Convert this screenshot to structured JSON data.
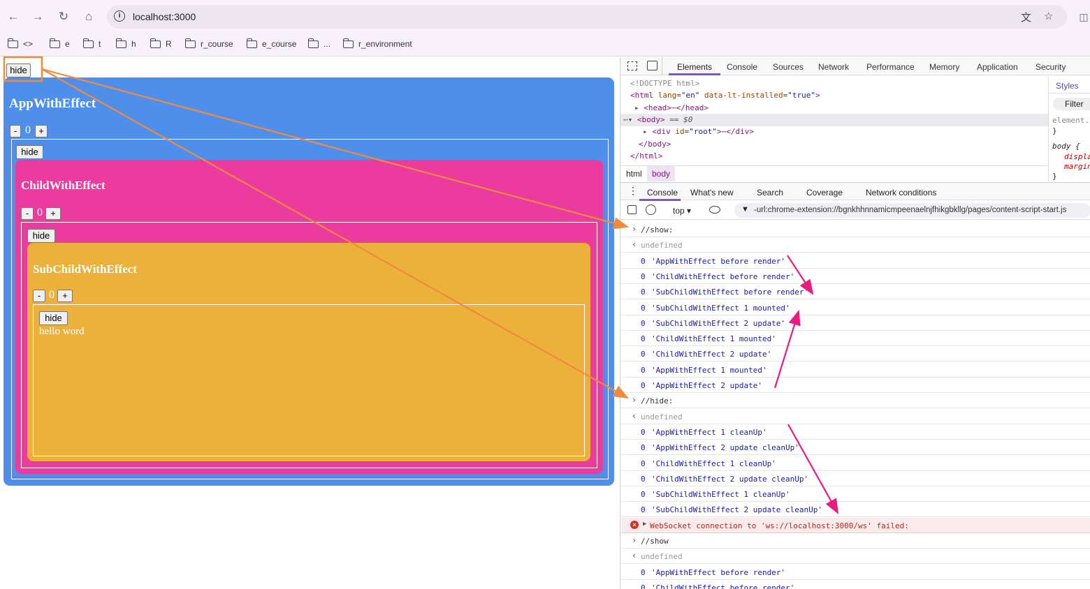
{
  "browser": {
    "url": "localhost:3000",
    "bookmarks": [
      "<>",
      "e",
      "t",
      "h",
      "R",
      "r_course",
      "e_course",
      "...",
      "r_environment"
    ]
  },
  "app": {
    "hide_label": "hide",
    "minus_label": "-",
    "plus_label": "+",
    "app_title": "AppWithEffect",
    "app_count": "0",
    "child_title": "ChildWithEffect",
    "child_count": "0",
    "subchild_title": "SubChildWithEffect",
    "subchild_count": "0",
    "content_text": "hello word",
    "colors": {
      "app": "#4f8fec",
      "child": "#eb3b9f",
      "subchild": "#ecb13a"
    }
  },
  "devtools": {
    "tabs": [
      "Elements",
      "Console",
      "Sources",
      "Network",
      "Performance",
      "Memory",
      "Application",
      "Security"
    ],
    "active_tab": "Elements",
    "elements": {
      "doctype": "<!DOCTYPE html>",
      "html_open_tag": "<html",
      "html_lang_attr": "lang",
      "html_lang_val": "\"en\"",
      "html_lt_attr": "data-lt-installed",
      "html_lt_val": "\"true\"",
      "html_open_end": ">",
      "head_line": "<head>",
      "head_close": "</head>",
      "body_line": "<body>",
      "body_eq": "== $0",
      "div_open": "<div",
      "div_id_attr": "id",
      "div_id_val": "\"root\"",
      "div_rest": ">",
      "div_close": "</div>",
      "body_close": "</body>",
      "html_close": "</html>",
      "ellipsis": "⋯"
    },
    "breadcrumbs": [
      "html",
      "body"
    ],
    "styles": {
      "tab": "Styles",
      "filter": "Filter",
      "element_rule": "element.s",
      "brace": "}",
      "body_sel": "body {",
      "prop1": "displa",
      "prop2": "margin"
    },
    "drawer_tabs": [
      "Console",
      "What's new",
      "Search",
      "Coverage",
      "Network conditions"
    ],
    "context": "top",
    "filter_text": "-url:chrome-extension://bgnkhhnnamicmpeenaelnjfhikgbkllg/pages/content-script-start.js",
    "console_lines": [
      {
        "kind": "cmd",
        "text": "//show:"
      },
      {
        "kind": "ret",
        "text": "undefined"
      },
      {
        "kind": "log",
        "n": "0",
        "text": "'AppWithEffect before render'"
      },
      {
        "kind": "log",
        "n": "0",
        "text": "'ChildWithEffect before render'"
      },
      {
        "kind": "log",
        "n": "0",
        "text": "'SubChildWithEffect before render'"
      },
      {
        "kind": "log",
        "n": "0",
        "text": "'SubChildWithEffect 1 mounted'"
      },
      {
        "kind": "log",
        "n": "0",
        "text": "'SubChildWithEffect 2 update'"
      },
      {
        "kind": "log",
        "n": "0",
        "text": "'ChildWithEffect 1 mounted'"
      },
      {
        "kind": "log",
        "n": "0",
        "text": "'ChildWithEffect 2 update'"
      },
      {
        "kind": "log",
        "n": "0",
        "text": "'AppWithEffect 1 mounted'"
      },
      {
        "kind": "log",
        "n": "0",
        "text": "'AppWithEffect 2 update'"
      },
      {
        "kind": "cmd",
        "text": "//hide:"
      },
      {
        "kind": "ret",
        "text": "undefined"
      },
      {
        "kind": "log",
        "n": "0",
        "text": "'AppWithEffect 1 cleanUp'"
      },
      {
        "kind": "log",
        "n": "0",
        "text": "'AppWithEffect 2 update cleanUp'"
      },
      {
        "kind": "log",
        "n": "0",
        "text": "'ChildWithEffect 1 cleanUp'"
      },
      {
        "kind": "log",
        "n": "0",
        "text": "'ChildWithEffect 2 update cleanUp'"
      },
      {
        "kind": "log",
        "n": "0",
        "text": "'SubChildWithEffect 1 cleanUp'"
      },
      {
        "kind": "log",
        "n": "0",
        "text": "'SubChildWithEffect 2 update cleanUp'"
      },
      {
        "kind": "err",
        "pre": "WebSocket connection to 'ws:",
        "link": "//localhost:3000",
        "post": "/ws' failed:"
      },
      {
        "kind": "cmd",
        "text": "//show"
      },
      {
        "kind": "ret",
        "text": "undefined"
      },
      {
        "kind": "log",
        "n": "0",
        "text": "'AppWithEffect before render'"
      },
      {
        "kind": "log",
        "n": "0",
        "text": "'ChildWithEffect before render'"
      }
    ]
  }
}
